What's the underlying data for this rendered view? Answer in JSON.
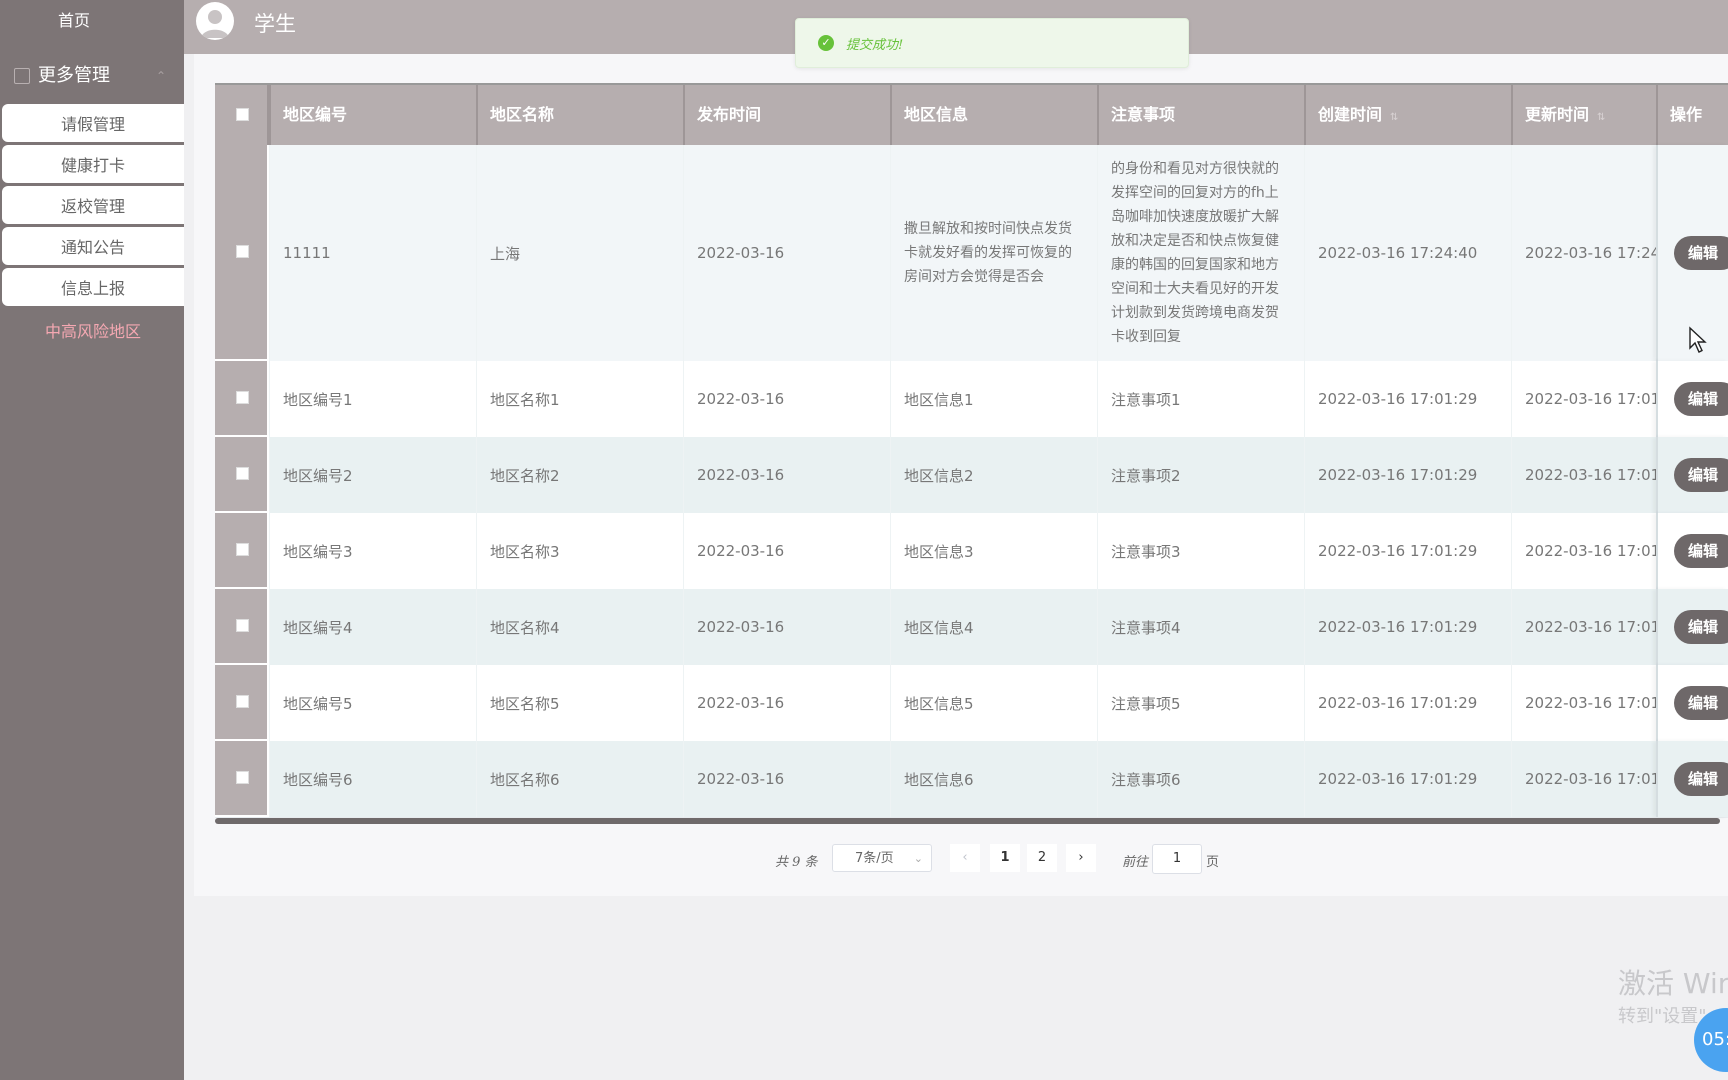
{
  "sidebar": {
    "home": "首页",
    "group": "更多管理",
    "items": [
      {
        "label": "请假管理"
      },
      {
        "label": "健康打卡"
      },
      {
        "label": "返校管理"
      },
      {
        "label": "通知公告"
      },
      {
        "label": "信息上报"
      },
      {
        "label": "中高风险地区"
      }
    ]
  },
  "header": {
    "title": "学生"
  },
  "toast": {
    "message": "提交成功!"
  },
  "table": {
    "columns": [
      "地区编号",
      "地区名称",
      "发布时间",
      "地区信息",
      "注意事项",
      "创建时间",
      "更新时间",
      "操作"
    ],
    "edit_label": "编辑",
    "rows": [
      {
        "code": "11111",
        "name": "上海",
        "publish": "2022-03-16",
        "info": "撒旦解放和按时间快点发货卡就发好看的发挥可恢复的房间对方会觉得是否会",
        "notes": "的身份和看见对方很快就的发挥空间的回复对方的fh上岛咖啡加快速度放暖扩大解放和决定是否和快点恢复健康的韩国的回复国家和地方空间和士大夫看见好的开发计划款到发货跨境电商发贺卡收到回复",
        "created": "2022-03-16 17:24:40",
        "updated": "2022-03-16 17:24"
      },
      {
        "code": "地区编号1",
        "name": "地区名称1",
        "publish": "2022-03-16",
        "info": "地区信息1",
        "notes": "注意事项1",
        "created": "2022-03-16 17:01:29",
        "updated": "2022-03-16 17:01"
      },
      {
        "code": "地区编号2",
        "name": "地区名称2",
        "publish": "2022-03-16",
        "info": "地区信息2",
        "notes": "注意事项2",
        "created": "2022-03-16 17:01:29",
        "updated": "2022-03-16 17:01"
      },
      {
        "code": "地区编号3",
        "name": "地区名称3",
        "publish": "2022-03-16",
        "info": "地区信息3",
        "notes": "注意事项3",
        "created": "2022-03-16 17:01:29",
        "updated": "2022-03-16 17:01"
      },
      {
        "code": "地区编号4",
        "name": "地区名称4",
        "publish": "2022-03-16",
        "info": "地区信息4",
        "notes": "注意事项4",
        "created": "2022-03-16 17:01:29",
        "updated": "2022-03-16 17:01"
      },
      {
        "code": "地区编号5",
        "name": "地区名称5",
        "publish": "2022-03-16",
        "info": "地区信息5",
        "notes": "注意事项5",
        "created": "2022-03-16 17:01:29",
        "updated": "2022-03-16 17:01"
      },
      {
        "code": "地区编号6",
        "name": "地区名称6",
        "publish": "2022-03-16",
        "info": "地区信息6",
        "notes": "注意事项6",
        "created": "2022-03-16 17:01:29",
        "updated": "2022-03-16 17:01"
      }
    ]
  },
  "pagination": {
    "total": "共 9 条",
    "page_size": "7条/页",
    "pages": [
      "1",
      "2"
    ],
    "goto_label": "前往",
    "goto_value": "1",
    "unit": "页",
    "prev": "‹",
    "next": "›"
  },
  "watermark": {
    "line1": "激活 Win",
    "line2": "转到\"设置\"",
    "clock": "05:"
  }
}
